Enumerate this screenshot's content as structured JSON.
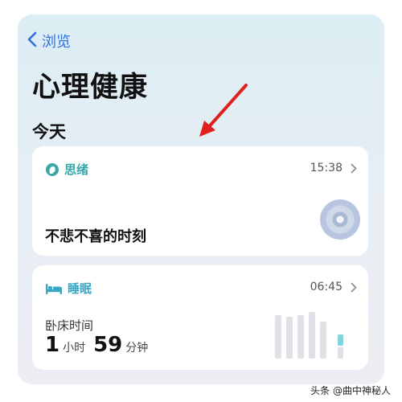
{
  "nav": {
    "back_label": "浏览"
  },
  "page": {
    "title": "心理健康",
    "section": "今天"
  },
  "mind_card": {
    "title": "思绪",
    "time": "15:38",
    "state": "不悲不喜的时刻",
    "accent": "#3aa6a8"
  },
  "sleep_card": {
    "title": "睡眠",
    "time": "06:45",
    "label": "卧床时间",
    "hours": "1",
    "hours_unit": "小时",
    "minutes": "59",
    "minutes_unit": "分钟",
    "accent": "#3aa6c2"
  },
  "watermark": "头条 @曲中神秘人",
  "colors": {
    "link": "#2f6fe0",
    "annotation_arrow": "#e0201b"
  }
}
